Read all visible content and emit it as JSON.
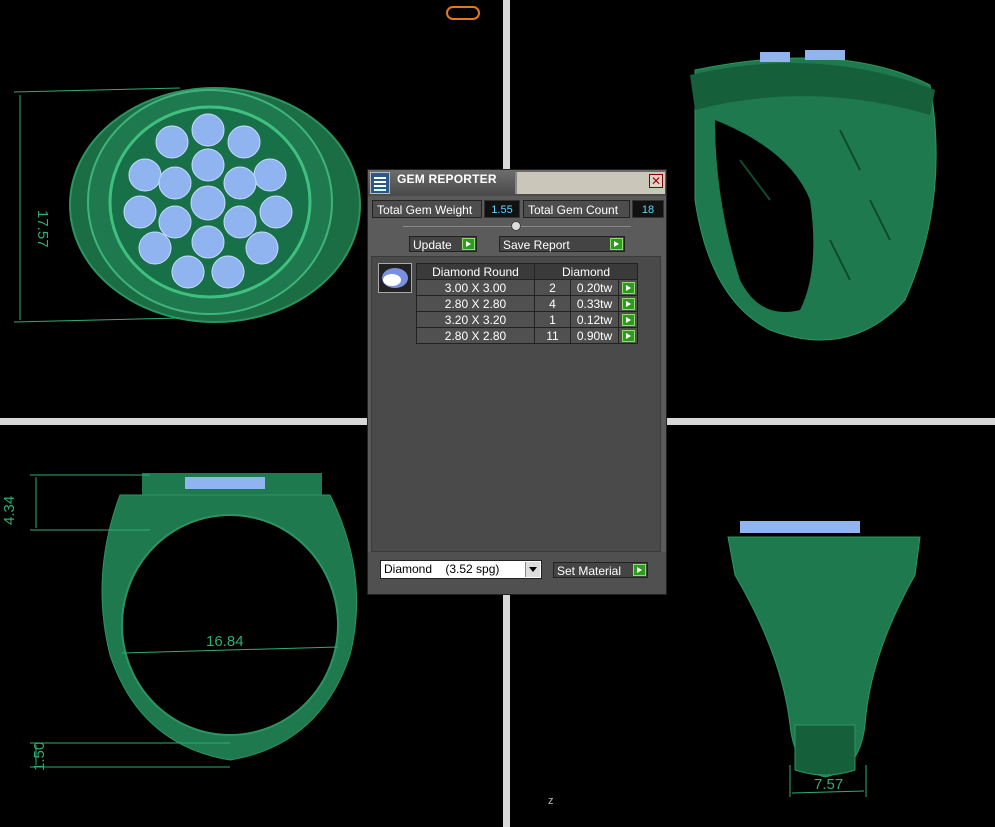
{
  "viewports": {
    "top_view": {
      "dimension": "17.57"
    },
    "front_view": {
      "dimension_top": "4.34",
      "dimension_width": "16.84",
      "dimension_bottom": "1.50"
    },
    "side_view": {
      "dimension_width": "7.57"
    },
    "axis": "z"
  },
  "dialog": {
    "title": "GEM REPORTER",
    "total_weight_label": "Total Gem Weight",
    "total_weight_value": "1.55",
    "total_count_label": "Total Gem Count",
    "total_count_value": "18",
    "update_label": "Update",
    "save_report_label": "Save Report",
    "table": {
      "headers": [
        "Diamond Round",
        "Diamond"
      ],
      "rows": [
        {
          "size": "3.00 X 3.00",
          "count": "2",
          "weight": "0.20tw"
        },
        {
          "size": "2.80 X 2.80",
          "count": "4",
          "weight": "0.33tw"
        },
        {
          "size": "3.20 X 3.20",
          "count": "1",
          "weight": "0.12tw"
        },
        {
          "size": "2.80 X 2.80",
          "count": "11",
          "weight": "0.90tw"
        }
      ]
    },
    "material_value": "Diamond    (3.52 spg)",
    "set_material_label": "Set Material"
  },
  "colors": {
    "model_green": "#1e7a4e",
    "gem_blue": "#8fb4f0",
    "dimension_green": "#2fae70"
  }
}
